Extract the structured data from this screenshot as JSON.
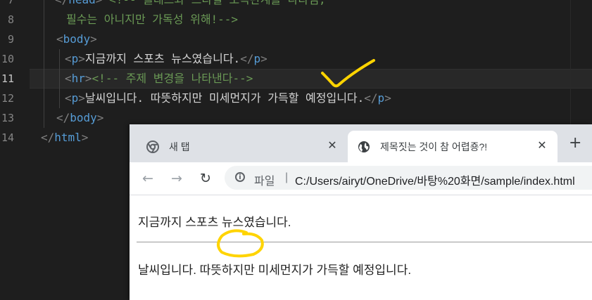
{
  "editor": {
    "line_numbers": [
      "7",
      "8",
      "9",
      "10",
      "11",
      "12",
      "13",
      "14"
    ],
    "line7": {
      "open": "</",
      "tag": "head",
      "close": ">",
      "comment": "<!-- 클래스와 스타일 소속관계를 나타냄,"
    },
    "line8": {
      "comment": "필수는 아니지만 가독성 위해!-->"
    },
    "line9": {
      "open": "<",
      "tag": "body",
      "close": ">"
    },
    "line10": {
      "open": "<",
      "tag": "p",
      "close": ">",
      "text": "지금까지 스포츠 뉴스였습니다.",
      "open2": "</",
      "tag2": "p",
      "close2": ">"
    },
    "line11": {
      "open": "<",
      "tag": "hr",
      "close": ">",
      "comment": "<!-- 주제 변경을 나타낸다-->"
    },
    "line12": {
      "open": "<",
      "tag": "p",
      "close": ">",
      "text": "날씨입니다. 따뜻하지만 미세먼지가 가득할 예정입니다.",
      "open2": "</",
      "tag2": "p",
      "close2": ">"
    },
    "line13": {
      "open": "</",
      "tag": "body",
      "close": ">"
    },
    "line14": {
      "open": "</",
      "tag": "html",
      "close": ">"
    }
  },
  "browser": {
    "tabs": [
      {
        "label": "새 탭",
        "icon": "chrome-icon",
        "close": "✕"
      },
      {
        "label": "제목짓는 것이 참 어렵죵?!",
        "icon": "globe-icon",
        "close": "✕"
      }
    ],
    "new_tab": "+",
    "nav": {
      "back": "←",
      "forward": "→",
      "reload": "↻"
    },
    "omnibox": {
      "scheme": "파일",
      "separator": "|",
      "url": "C:/Users/airyt/OneDrive/바탕%20화면/sample/index.html"
    },
    "page": {
      "paragraph1": "지금까지 스포츠 뉴스였습니다.",
      "paragraph2": "날씨입니다. 따뜻하지만 미세먼지가 가득할 예정입니다."
    }
  },
  "annotations": {
    "color": "#ffd400"
  }
}
